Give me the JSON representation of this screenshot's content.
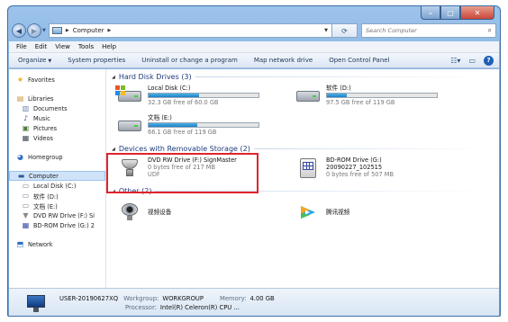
{
  "window": {
    "controls": {
      "minimize": "–",
      "maximize": "□",
      "close": "✕"
    }
  },
  "address": {
    "crumbs": [
      "Computer"
    ],
    "search_placeholder": "Search Computer"
  },
  "menu": [
    "File",
    "Edit",
    "View",
    "Tools",
    "Help"
  ],
  "commands": {
    "organize": "Organize",
    "system_properties": "System properties",
    "uninstall": "Uninstall or change a program",
    "map_drive": "Map network drive",
    "control_panel": "Open Control Panel"
  },
  "nav": {
    "favorites": "Favorites",
    "libraries": "Libraries",
    "documents": "Documents",
    "music": "Music",
    "pictures": "Pictures",
    "videos": "Videos",
    "homegroup": "Homegroup",
    "computer": "Computer",
    "local_c": "Local Disk (C:)",
    "drive_d": "软件 (D:)",
    "drive_e": "文档 (E:)",
    "dvd_f": "DVD RW Drive (F:) Si",
    "bd_g": "BD-ROM Drive (G:) 2",
    "network": "Network"
  },
  "groups": {
    "hdd": "Hard Disk Drives (3)",
    "removable": "Devices with Removable Storage (2)",
    "other": "Other (2)"
  },
  "drives": [
    {
      "name": "Local Disk (C:)",
      "free": "32.3 GB free of 60.0 GB",
      "used_fraction": 0.46,
      "bar_color": "#1f7fc6"
    },
    {
      "name": "软件 (D:)",
      "free": "97.5 GB free of 119 GB",
      "used_fraction": 0.18,
      "bar_color": "#1f7fc6"
    },
    {
      "name": "文档 (E:)",
      "free": "66.1 GB free of 119 GB",
      "used_fraction": 0.44,
      "bar_color": "#1f7fc6"
    }
  ],
  "removable": [
    {
      "name": "DVD RW Drive (F:) SignMaster",
      "line2": "0 bytes free of 217 MB",
      "line3": "UDF"
    },
    {
      "name": "BD-ROM Drive (G:)",
      "line2": "20090227_102515",
      "line3": "0 bytes free of 507 MB"
    }
  ],
  "other": [
    {
      "name": "视频设备"
    },
    {
      "name": "腾讯视频"
    }
  ],
  "details": {
    "pc_name": "USER-20190627XQ",
    "workgroup_label": "Workgroup:",
    "workgroup": "WORKGROUP",
    "memory_label": "Memory:",
    "memory": "4.00 GB",
    "processor_label": "Processor:",
    "processor": "Intel(R) Celeron(R) CPU ..."
  },
  "colors": {
    "highlight_box": "#e0242a",
    "accent": "#1f7fc6"
  }
}
